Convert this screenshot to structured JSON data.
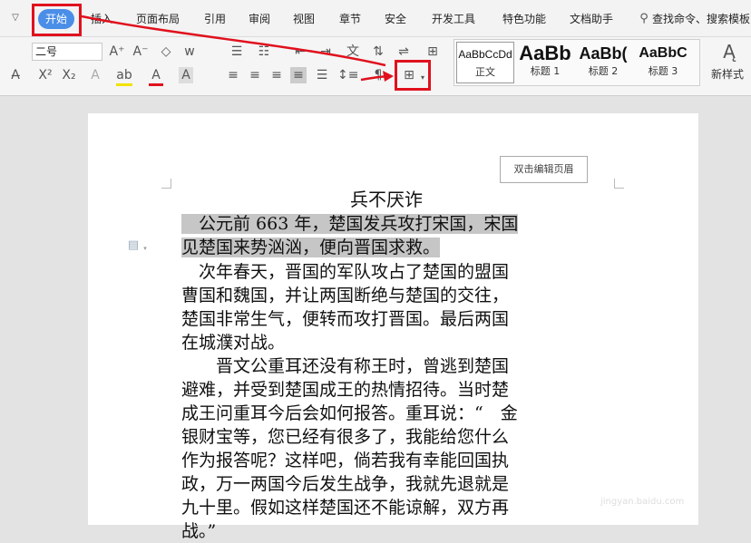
{
  "menu": {
    "start": "开始",
    "insert": "插入",
    "page_layout": "页面布局",
    "reference": "引用",
    "review": "审阅",
    "view": "视图",
    "section": "章节",
    "security": "安全",
    "dev_tools": "开发工具",
    "special": "特色功能",
    "doc_helper": "文档助手",
    "search": "查找命令、搜索模板"
  },
  "ribbon": {
    "font_size": "二号",
    "styles": [
      {
        "sample": "AaBbCcDd",
        "name": "正文"
      },
      {
        "sample": "AaBb",
        "name": "标题 1"
      },
      {
        "sample": "AaBb(",
        "name": "标题 2"
      },
      {
        "sample": "AaBbC",
        "name": "标题 3"
      }
    ],
    "new_style": "新样式"
  },
  "document": {
    "header_button": "双击编辑页眉",
    "title": "兵不厌诈",
    "p1_l1": "　公元前 663 年，楚国发兵攻打宋国，宋国",
    "p1_l2": "见楚国来势汹汹，便向晋国求救。",
    "p2_l1": "　次年春天，晋国的军队攻占了楚国的盟国",
    "p2_l2": "曹国和魏国，并让两国断绝与楚国的交往，",
    "p2_l3": "楚国非常生气，便转而攻打晋国。最后两国",
    "p2_l4": "在城濮对战。",
    "p3_l1": "　　晋文公重耳还没有称王时，曾逃到楚国",
    "p3_l2": "避难，并受到楚国成王的热情招待。当时楚",
    "p3_l3": "成王问重耳今后会如何报答。重耳说：“　金",
    "p3_l4": "银财宝等，您已经有很多了，我能给您什么",
    "p3_l5": "作为报答呢？这样吧，倘若我有幸能回国执",
    "p3_l6": "政，万一两国今后发生战争，我就先退就是",
    "p3_l7": "九十里。假如这样楚国还不能谅解，双方再",
    "p3_l8": "战。”"
  },
  "watermark": {
    "brand": "经验",
    "url": "jingyan.baidu.com"
  },
  "colors": {
    "accent": "#4a8ee8",
    "annotation": "#e0111d",
    "highlight": "#c6c6c6"
  }
}
